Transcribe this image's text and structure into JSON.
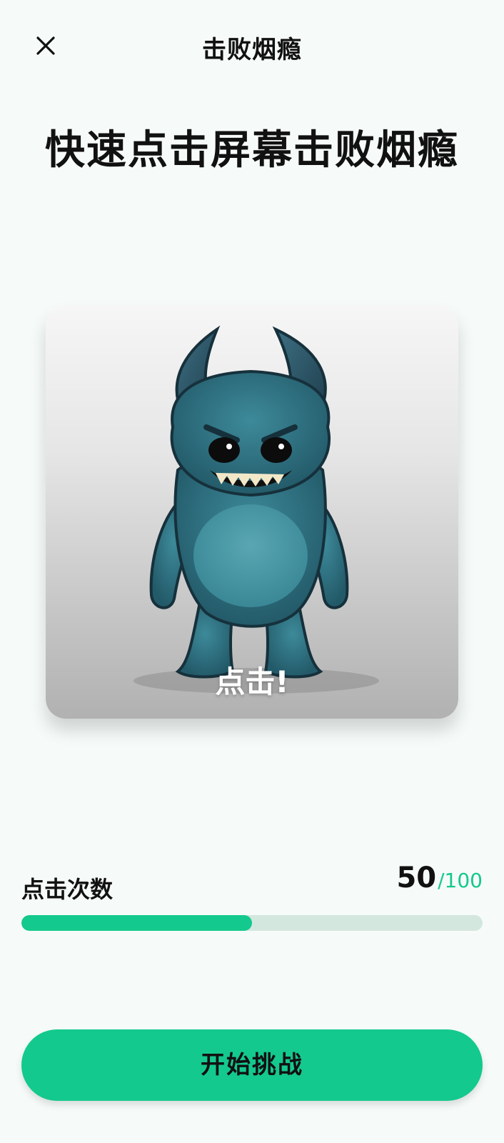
{
  "header": {
    "title": "击败烟瘾",
    "close_icon": "close-icon"
  },
  "headline": "快速点击屏幕击败烟瘾",
  "monster": {
    "tap_label": "点击!",
    "image_name": "monster-illustration"
  },
  "counter": {
    "label": "点击次数",
    "value": "50",
    "max": "/100",
    "progress_fraction": 0.5
  },
  "start_button": {
    "label": "开始挑战"
  },
  "colors": {
    "accent": "#14c98d",
    "track": "#d4e7df",
    "background": "#f6fbf9"
  }
}
